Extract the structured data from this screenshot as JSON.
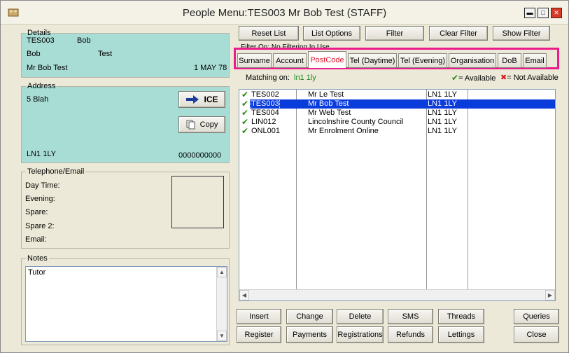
{
  "window": {
    "title": "People Menu:TES003 Mr Bob Test (STAFF)"
  },
  "details": {
    "legend": "Details",
    "code": "TES003",
    "known_as": "Bob",
    "forename": "Bob",
    "surname": "Test",
    "full_name": "Mr Bob Test",
    "date": "1 MAY 78"
  },
  "address": {
    "legend": "Address",
    "line1": "5 Blah",
    "postcode": "LN1 1LY",
    "number": "0000000000",
    "ice_label": "ICE",
    "copy_label": "Copy"
  },
  "telephone": {
    "legend": "Telephone/Email",
    "day_time": "Day Time:",
    "evening": "Evening:",
    "spare": "Spare:",
    "spare2": "Spare 2:",
    "email": "Email:"
  },
  "notes": {
    "legend": "Notes",
    "value": "Tutor"
  },
  "filter_buttons": {
    "reset_list": "Reset List",
    "list_options": "List Options",
    "filter": "Filter",
    "clear_filter": "Clear Filter",
    "show_filter": "Show Filter"
  },
  "filter_status": "Filter On: No Filtering In Use",
  "tabs": [
    {
      "label": "Surname"
    },
    {
      "label": "Account"
    },
    {
      "label": "PostCode"
    },
    {
      "label": "Tel (Daytime)"
    },
    {
      "label": "Tel (Evening)"
    },
    {
      "label": "Organisation"
    },
    {
      "label": "DoB"
    },
    {
      "label": "Email"
    }
  ],
  "matching": {
    "label": "Matching on:",
    "value": "ln1 1ly",
    "available": "= Available",
    "not_available": "= Not Available"
  },
  "list": {
    "rows": [
      {
        "code": "TES002",
        "name": "Mr Le Test",
        "postcode": "LN1 1LY"
      },
      {
        "code": "TES003",
        "name": "Mr Bob Test",
        "postcode": "LN1 1LY"
      },
      {
        "code": "TES004",
        "name": "Mr Web Test",
        "postcode": "LN1 1LY"
      },
      {
        "code": "LIN012",
        "name": "Lincolnshire County Council",
        "postcode": "LN1 1LY"
      },
      {
        "code": "ONL001",
        "name": "Mr Enrolment Online",
        "postcode": "LN1 1LY"
      }
    ],
    "selected_code": "TES003"
  },
  "actions": {
    "insert": "Insert",
    "change": "Change",
    "delete": "Delete",
    "sms": "SMS",
    "threads": "Threads",
    "queries": "Queries",
    "register": "Register",
    "payments": "Payments",
    "registrations": "Registrations",
    "refunds": "Refunds",
    "lettings": "Lettings",
    "close": "Close"
  },
  "colors": {
    "highlight": "#ec1c8c",
    "selection": "#0a3cdc",
    "panel_teal": "#a8ddd6",
    "active_tab_text": "#e0142b"
  }
}
